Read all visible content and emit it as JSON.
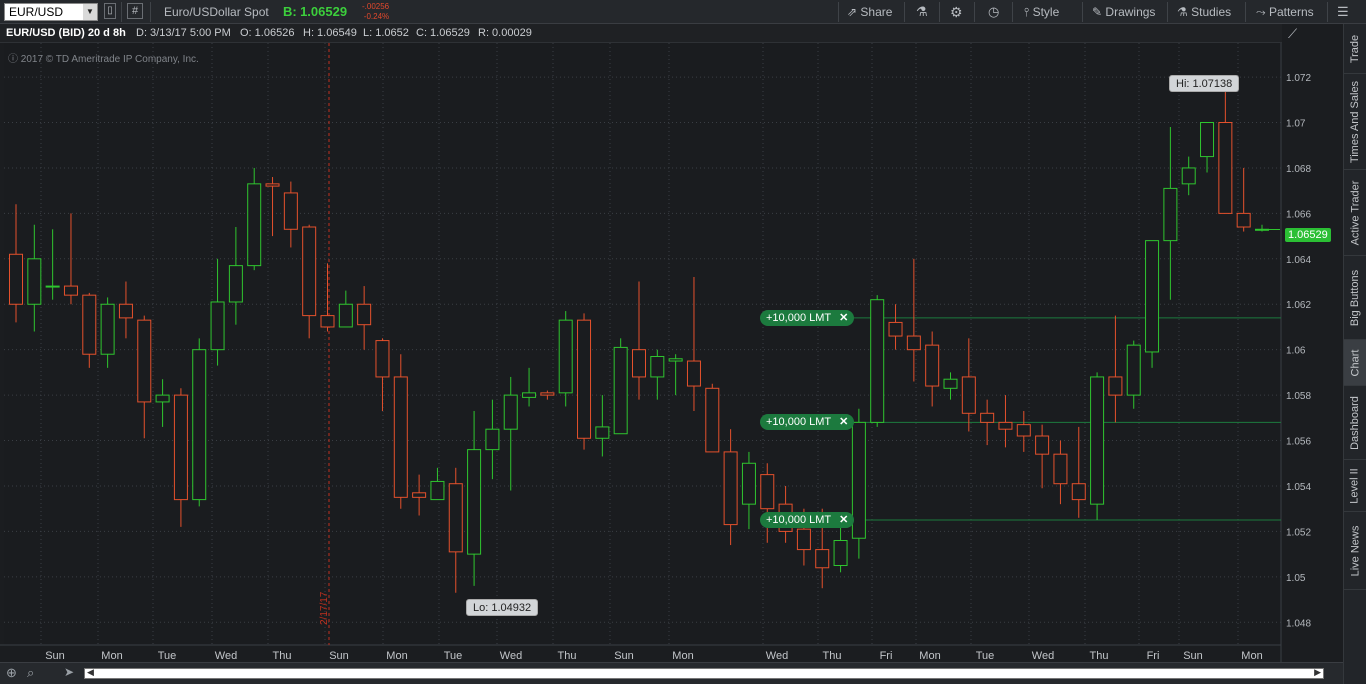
{
  "toolbar": {
    "symbol": "EUR/USD",
    "description": "Euro/USDollar Spot",
    "bid_label": "B:",
    "bid_value": "1.06529",
    "change_abs": "-.00256",
    "change_pct": "-0.24%",
    "share": "Share",
    "style": "Style",
    "drawings": "Drawings",
    "studies": "Studies",
    "patterns": "Patterns"
  },
  "infobar": {
    "title": "EUR/USD (BID) 20 d 8h",
    "date": "D: 3/13/17 5:00 PM",
    "open": "O: 1.06526",
    "high": "H: 1.06549",
    "low": "L: 1.0652",
    "close": "C: 1.06529",
    "range": "R: 0.00029"
  },
  "copyright": "2017 © TD Ameritrade IP Company, Inc.",
  "hi_callout": "Hi: 1.07138",
  "lo_callout": "Lo: 1.04932",
  "last_price_tag": "1.06529",
  "orders": [
    {
      "label": "+10,000 LMT",
      "price": 1.0614
    },
    {
      "label": "+10,000 LMT",
      "price": 1.0568
    },
    {
      "label": "+10,000 LMT",
      "price": 1.0525
    }
  ],
  "date_marker": "2/17/17",
  "right_tabs": [
    "Trade",
    "Times And Sales",
    "Active Trader",
    "Big Buttons",
    "Chart",
    "Dashboard",
    "Level II",
    "Live News"
  ],
  "colors": {
    "up": "#2fc52f",
    "down": "#e4512c",
    "order": "#1c7a3e",
    "grid": "#3a3e44"
  },
  "chart_data": {
    "type": "candlestick",
    "y_ticks": [
      "1.072",
      "1.07",
      "1.068",
      "1.066",
      "1.064",
      "1.062",
      "1.06",
      "1.058",
      "1.056",
      "1.054",
      "1.052",
      "1.05",
      "1.048"
    ],
    "ylim": [
      1.047,
      1.0735
    ],
    "x_day_labels": [
      "Sun",
      "Mon",
      "Tue",
      "Wed",
      "Thu",
      "Sun",
      "Mon",
      "Tue",
      "Wed",
      "Thu",
      "Sun",
      "Mon",
      "Wed",
      "Thu",
      "Fri",
      "Mon",
      "Tue",
      "Wed",
      "Thu",
      "Fri",
      "Sun",
      "Mon"
    ],
    "candles": [
      [
        1.0642,
        1.0664,
        1.0612,
        1.062
      ],
      [
        1.062,
        1.0655,
        1.0608,
        1.064
      ],
      [
        1.0628,
        1.0653,
        1.0622,
        1.0628
      ],
      [
        1.0628,
        1.066,
        1.062,
        1.0624
      ],
      [
        1.0624,
        1.0625,
        1.0592,
        1.0598
      ],
      [
        1.0598,
        1.0623,
        1.0592,
        1.062
      ],
      [
        1.062,
        1.063,
        1.0605,
        1.0614
      ],
      [
        1.0613,
        1.0615,
        1.0561,
        1.0577
      ],
      [
        1.0577,
        1.0587,
        1.0566,
        1.058
      ],
      [
        1.058,
        1.0583,
        1.0522,
        1.0534
      ],
      [
        1.0534,
        1.0605,
        1.0531,
        1.06
      ],
      [
        1.06,
        1.064,
        1.0593,
        1.0621
      ],
      [
        1.0621,
        1.0654,
        1.0611,
        1.0637
      ],
      [
        1.0637,
        1.068,
        1.0635,
        1.0673
      ],
      [
        1.0673,
        1.0676,
        1.065,
        1.0672
      ],
      [
        1.0669,
        1.0674,
        1.0645,
        1.0653
      ],
      [
        1.0654,
        1.0655,
        1.0605,
        1.0615
      ],
      [
        1.0615,
        1.0638,
        1.0608,
        1.061
      ],
      [
        1.061,
        1.0626,
        1.061,
        1.062
      ],
      [
        1.062,
        1.0628,
        1.06,
        1.0611
      ],
      [
        1.0604,
        1.0605,
        1.0573,
        1.0588
      ],
      [
        1.0588,
        1.0598,
        1.053,
        1.0535
      ],
      [
        1.0537,
        1.0545,
        1.0527,
        1.0535
      ],
      [
        1.0534,
        1.0548,
        1.0534,
        1.0542
      ],
      [
        1.0541,
        1.0548,
        1.0493,
        1.0511
      ],
      [
        1.051,
        1.0573,
        1.0496,
        1.0556
      ],
      [
        1.0556,
        1.0578,
        1.0543,
        1.0565
      ],
      [
        1.0565,
        1.0588,
        1.0538,
        1.058
      ],
      [
        1.0579,
        1.0592,
        1.0575,
        1.0581
      ],
      [
        1.0581,
        1.0582,
        1.0578,
        1.058
      ],
      [
        1.0581,
        1.0617,
        1.0575,
        1.0613
      ],
      [
        1.0613,
        1.0616,
        1.0556,
        1.0561
      ],
      [
        1.0561,
        1.058,
        1.0553,
        1.0566
      ],
      [
        1.0563,
        1.0605,
        1.0563,
        1.0601
      ],
      [
        1.06,
        1.063,
        1.0578,
        1.0588
      ],
      [
        1.0588,
        1.06,
        1.0578,
        1.0597
      ],
      [
        1.0595,
        1.0598,
        1.058,
        1.0596
      ],
      [
        1.0595,
        1.0632,
        1.0573,
        1.0584
      ],
      [
        1.0583,
        1.0585,
        1.0556,
        1.0555
      ],
      [
        1.0555,
        1.0565,
        1.0514,
        1.0523
      ],
      [
        1.0532,
        1.0555,
        1.0521,
        1.055
      ],
      [
        1.0545,
        1.055,
        1.0515,
        1.053
      ],
      [
        1.0532,
        1.054,
        1.0515,
        1.052
      ],
      [
        1.0521,
        1.053,
        1.0505,
        1.0512
      ],
      [
        1.0512,
        1.053,
        1.0495,
        1.0504
      ],
      [
        1.0505,
        1.0525,
        1.0502,
        1.0516
      ],
      [
        1.0517,
        1.0574,
        1.0508,
        1.0568
      ],
      [
        1.0568,
        1.0624,
        1.0566,
        1.0622
      ],
      [
        1.0612,
        1.062,
        1.06,
        1.0606
      ],
      [
        1.0606,
        1.064,
        1.0586,
        1.06
      ],
      [
        1.0602,
        1.0608,
        1.0575,
        1.0584
      ],
      [
        1.0583,
        1.059,
        1.0578,
        1.0587
      ],
      [
        1.0588,
        1.0605,
        1.0564,
        1.0572
      ],
      [
        1.0572,
        1.0578,
        1.0558,
        1.0568
      ],
      [
        1.0568,
        1.058,
        1.0557,
        1.0565
      ],
      [
        1.0567,
        1.0573,
        1.0555,
        1.0562
      ],
      [
        1.0562,
        1.0567,
        1.0539,
        1.0554
      ],
      [
        1.0554,
        1.056,
        1.0532,
        1.0541
      ],
      [
        1.0541,
        1.0566,
        1.0526,
        1.0534
      ],
      [
        1.0532,
        1.059,
        1.0525,
        1.0588
      ],
      [
        1.0588,
        1.0615,
        1.0568,
        1.058
      ],
      [
        1.058,
        1.0604,
        1.0574,
        1.0602
      ],
      [
        1.0599,
        1.0647,
        1.0592,
        1.0648
      ],
      [
        1.0648,
        1.0698,
        1.0622,
        1.0671
      ],
      [
        1.0673,
        1.0685,
        1.0668,
        1.068
      ],
      [
        1.0685,
        1.07,
        1.0678,
        1.07
      ],
      [
        1.07,
        1.0714,
        1.066,
        1.066
      ],
      [
        1.066,
        1.068,
        1.0652,
        1.0654
      ],
      [
        1.0653,
        1.0655,
        1.0652,
        1.0653
      ]
    ]
  }
}
